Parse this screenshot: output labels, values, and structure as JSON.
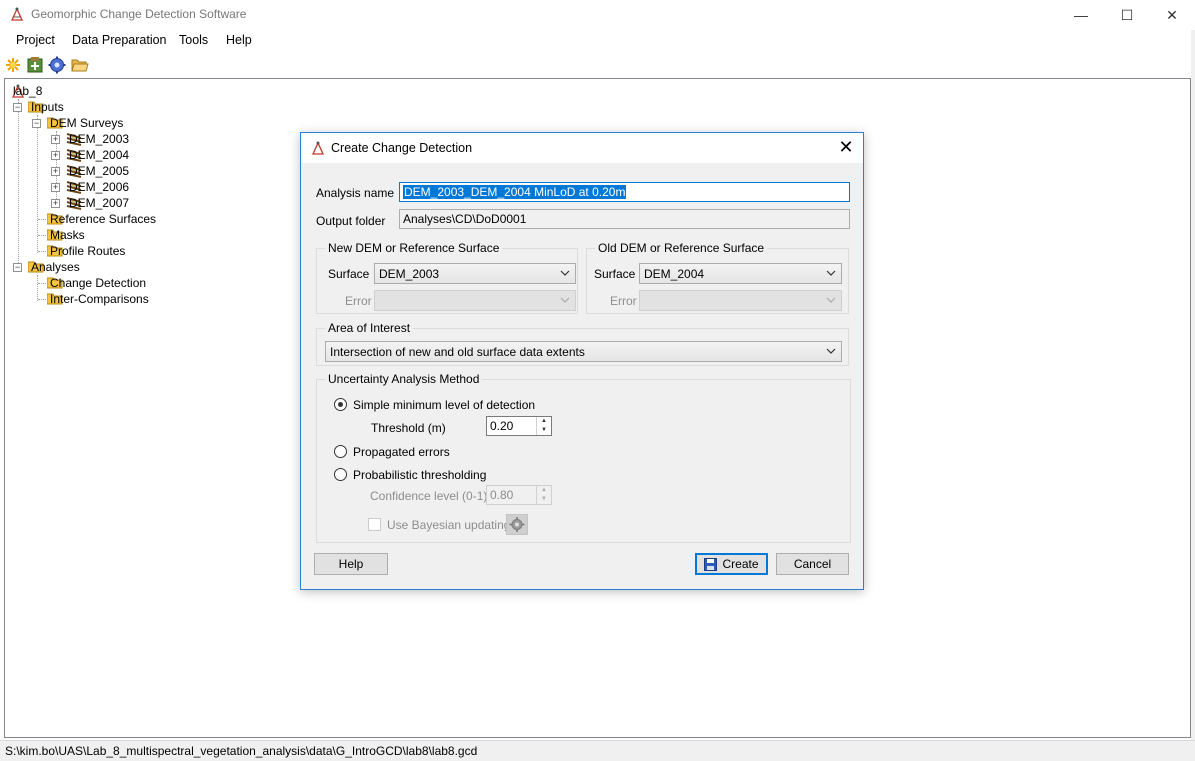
{
  "window": {
    "title": "Geomorphic Change Detection Software",
    "controls": {
      "minimize": "—",
      "maximize": "☐",
      "close": "✕"
    }
  },
  "menu": [
    "Project",
    "Data Preparation",
    "Tools",
    "Help"
  ],
  "toolbar": {
    "icons": [
      "new-project-icon",
      "add-icon",
      "settings-icon",
      "open-folder-icon"
    ]
  },
  "tree": {
    "root": "lab_8",
    "inputs": "Inputs",
    "dem_surveys": "DEM Surveys",
    "dems": [
      "DEM_2003",
      "DEM_2004",
      "DEM_2005",
      "DEM_2006",
      "DEM_2007"
    ],
    "reference_surfaces": "Reference Surfaces",
    "masks": "Masks",
    "profile_routes": "Profile Routes",
    "analyses": "Analyses",
    "change_detection": "Change Detection",
    "inter_comparisons": "Inter-Comparisons"
  },
  "status": {
    "path": "S:\\kim.bo\\UAS\\Lab_8_multispectral_vegetation_analysis\\data\\G_IntroGCD\\lab8\\lab8.gcd"
  },
  "dialog": {
    "title": "Create Change Detection",
    "analysis_name_label": "Analysis name",
    "analysis_name_value": "DEM_2003_DEM_2004 MinLoD at 0.20m",
    "output_folder_label": "Output folder",
    "output_folder_value": "Analyses\\CD\\DoD0001",
    "new_group": {
      "title": "New DEM or Reference Surface",
      "surface_label": "Surface",
      "surface_value": "DEM_2003",
      "error_label": "Error",
      "error_value": ""
    },
    "old_group": {
      "title": "Old DEM or Reference Surface",
      "surface_label": "Surface",
      "surface_value": "DEM_2004",
      "error_label": "Error",
      "error_value": ""
    },
    "aoi": {
      "title": "Area of Interest",
      "value": "Intersection of new and old surface data extents"
    },
    "uncertainty": {
      "title": "Uncertainty Analysis Method",
      "opt_simple": "Simple minimum level of detection",
      "threshold_label": "Threshold (m)",
      "threshold_value": "0.20",
      "opt_propagated": "Propagated errors",
      "opt_probabilistic": "Probabilistic thresholding",
      "confidence_label": "Confidence level (0-1)",
      "confidence_value": "0.80",
      "bayesian_label": "Use Bayesian updating",
      "selected": "simple"
    },
    "buttons": {
      "help": "Help",
      "create": "Create",
      "cancel": "Cancel"
    }
  }
}
